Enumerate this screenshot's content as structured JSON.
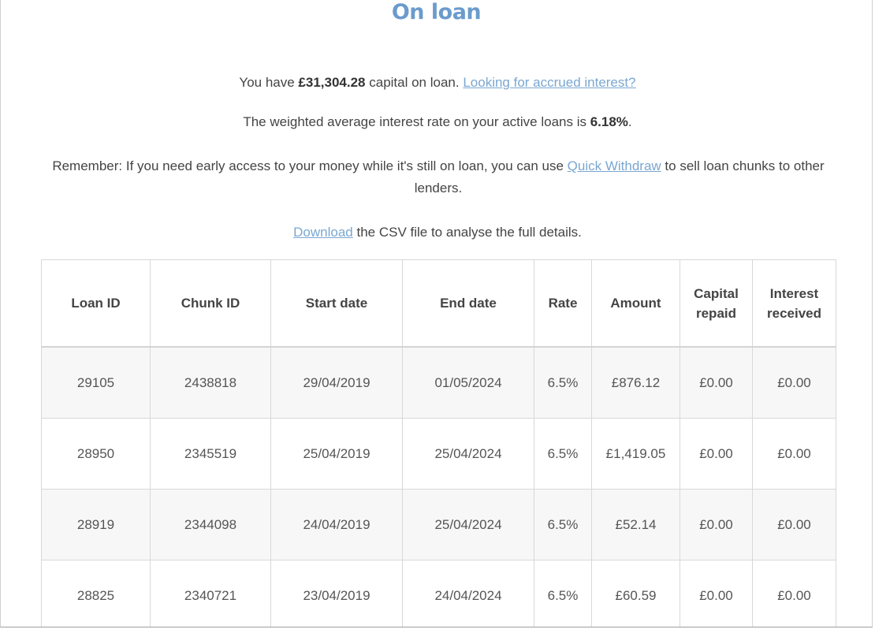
{
  "page": {
    "title": "On loan"
  },
  "summary": {
    "capital_prefix": "You have ",
    "capital_amount": "£31,304.28",
    "capital_suffix": " capital on loan. ",
    "accrued_link": "Looking for accrued interest?",
    "rate_prefix": "The weighted average interest rate on your active loans is ",
    "rate_value": "6.18%",
    "rate_suffix": ".",
    "remember_prefix": "Remember: If you need early access to your money while it's still on loan, you can use ",
    "quick_withdraw_link": "Quick Withdraw",
    "remember_suffix": " to sell loan chunks to other lenders.",
    "download_link": "Download",
    "download_suffix": " the CSV file to analyse the full details."
  },
  "colors": {
    "title": "#6a9bcc",
    "link": "#7aa7d1",
    "row_stripe": "#f7f7f7",
    "border": "#d8d8d8"
  },
  "table": {
    "headers": {
      "loan_id": "Loan ID",
      "chunk_id": "Chunk ID",
      "start_date": "Start date",
      "end_date": "End date",
      "rate": "Rate",
      "amount": "Amount",
      "capital_repaid_1": "Capital",
      "capital_repaid_2": "repaid",
      "interest_received_1": "Interest",
      "interest_received_2": "received"
    },
    "rows": [
      {
        "loan_id": "29105",
        "chunk_id": "2438818",
        "start_date": "29/04/2019",
        "end_date": "01/05/2024",
        "rate": "6.5%",
        "amount": "£876.12",
        "capital_repaid": "£0.00",
        "interest_received": "£0.00"
      },
      {
        "loan_id": "28950",
        "chunk_id": "2345519",
        "start_date": "25/04/2019",
        "end_date": "25/04/2024",
        "rate": "6.5%",
        "amount": "£1,419.05",
        "capital_repaid": "£0.00",
        "interest_received": "£0.00"
      },
      {
        "loan_id": "28919",
        "chunk_id": "2344098",
        "start_date": "24/04/2019",
        "end_date": "25/04/2024",
        "rate": "6.5%",
        "amount": "£52.14",
        "capital_repaid": "£0.00",
        "interest_received": "£0.00"
      },
      {
        "loan_id": "28825",
        "chunk_id": "2340721",
        "start_date": "23/04/2019",
        "end_date": "24/04/2024",
        "rate": "6.5%",
        "amount": "£60.59",
        "capital_repaid": "£0.00",
        "interest_received": "£0.00"
      }
    ]
  }
}
